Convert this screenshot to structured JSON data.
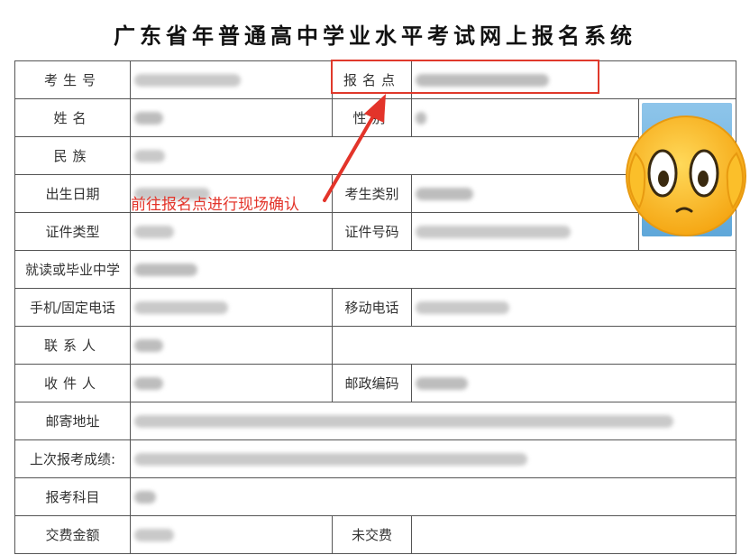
{
  "page": {
    "title": "广东省年普通高中学业水平考试网上报名系统"
  },
  "labels": {
    "exam_number": "考生号",
    "registration_point": "报名点",
    "name": "姓名",
    "gender": "性别",
    "ethnicity": "民族",
    "birth_date": "出生日期",
    "candidate_type": "考生类别",
    "id_type": "证件类型",
    "id_number": "证件号码",
    "school": "就读或毕业中学",
    "phone": "手机/固定电话",
    "mobile": "移动电话",
    "contact_person": "联系人",
    "recipient": "收件人",
    "postal_code": "邮政编码",
    "mailing_address": "邮寄地址",
    "last_results": "上次报考成绩:",
    "subjects": "报考科目",
    "fee_amount": "交费金额",
    "payment_status": "未交费"
  },
  "annotation": {
    "text": "前往报名点进行现场确认"
  },
  "colors": {
    "annotation": "#e3342a",
    "border": "#555555",
    "photo_bg": "#6fb3e0"
  },
  "icons": {
    "sticker": "shocked-emoji-icon",
    "pointer": "red-arrow-icon"
  }
}
